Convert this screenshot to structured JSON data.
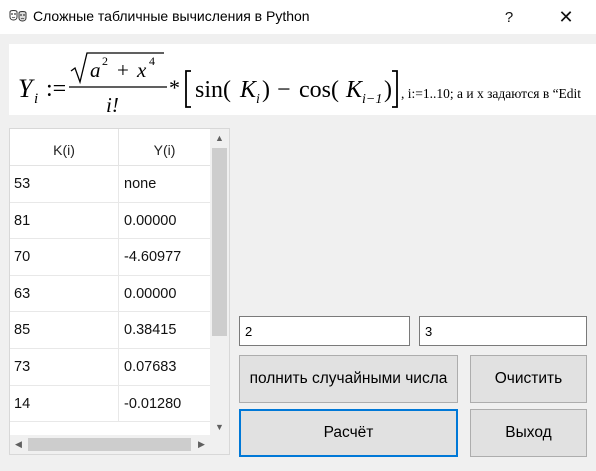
{
  "window": {
    "title": "Сложные табличные вычисления в Python",
    "help_glyph": "?",
    "close_glyph": "✕",
    "icon": "masks-icon"
  },
  "formula": {
    "lhs": "Y",
    "lhs_sub": "i",
    "assign": ":=",
    "numerator_a": "a",
    "numerator_x": "x",
    "exp2": "2",
    "exp4": "4",
    "plus": "+",
    "denominator": "i!",
    "times": "*",
    "sin": "sin(",
    "k": "K",
    "k_sub_i": "i",
    "close_paren": ")",
    "minus": "−",
    "cos": "cos(",
    "k_sub_prev": "i−1",
    "trailing": ", i:=1..10; a и x  задаются в “Edit"
  },
  "table": {
    "columns": [
      "K(i)",
      "Y(i)"
    ],
    "rows": [
      {
        "k": "53",
        "y": "none"
      },
      {
        "k": "81",
        "y": "0.00000"
      },
      {
        "k": "70",
        "y": "-4.60977"
      },
      {
        "k": "63",
        "y": "0.00000"
      },
      {
        "k": "85",
        "y": "0.38415"
      },
      {
        "k": "73",
        "y": "0.07683"
      },
      {
        "k": "14",
        "y": "-0.01280"
      }
    ]
  },
  "inputs": {
    "a_value": "2",
    "x_value": "3"
  },
  "buttons": {
    "fill_random": "полнить случайными числа",
    "clear": "Очистить",
    "calculate": "Расчёт",
    "exit": "Выход"
  },
  "scroll": {
    "up": "▲",
    "down": "▼",
    "left": "◀",
    "right": "▶"
  }
}
